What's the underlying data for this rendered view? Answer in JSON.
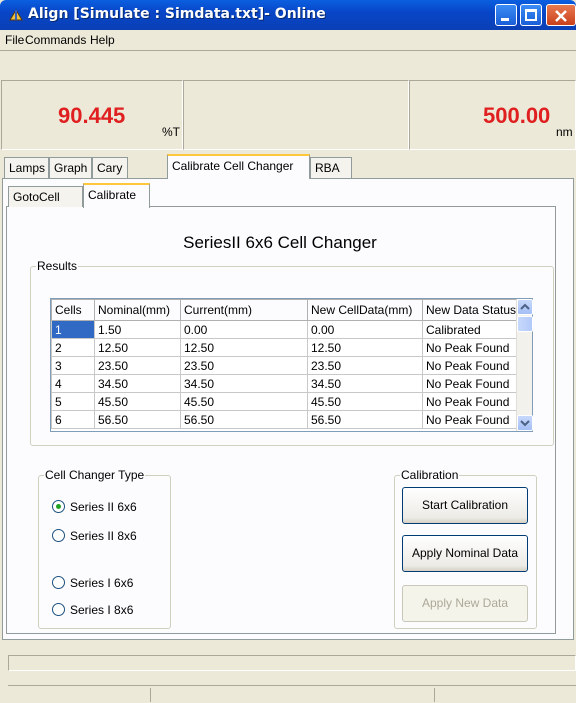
{
  "window": {
    "title": "Align [Simulate : Simdata.txt]- Online"
  },
  "menu": [
    {
      "label": "File"
    },
    {
      "label": "Commands"
    },
    {
      "label": "Help"
    }
  ],
  "readouts": {
    "transmittance": {
      "value": "90.445",
      "unit": "%T"
    },
    "wavelength": {
      "value": "500.00",
      "unit": "nm"
    }
  },
  "tabs": [
    "Lamps",
    "Graph",
    "Cary",
    "Calibrate Cell Changer",
    "RBA"
  ],
  "active_tab": "Calibrate Cell Changer",
  "subtabs": [
    "GotoCell",
    "Calibrate"
  ],
  "active_subtab": "Calibrate",
  "cell_changer_title": "SeriesII 6x6 Cell Changer",
  "results": {
    "label": "Results",
    "columns": [
      "Cells",
      "Nominal(mm)",
      "Current(mm)",
      "New CellData(mm)",
      "New Data Status"
    ],
    "rows": [
      [
        "1",
        "1.50",
        "0.00",
        "0.00",
        "Calibrated"
      ],
      [
        "2",
        "12.50",
        "12.50",
        "12.50",
        "No Peak Found"
      ],
      [
        "3",
        "23.50",
        "23.50",
        "23.50",
        "No Peak Found"
      ],
      [
        "4",
        "34.50",
        "34.50",
        "34.50",
        "No Peak Found"
      ],
      [
        "5",
        "45.50",
        "45.50",
        "45.50",
        "No Peak Found"
      ],
      [
        "6",
        "56.50",
        "56.50",
        "56.50",
        "No Peak Found"
      ]
    ]
  },
  "cell_changer_type": {
    "label": "Cell Changer Type",
    "options": [
      "Series II 6x6",
      "Series II 8x6",
      "Series I 6x6",
      "Series I 8x6"
    ],
    "selected": "Series II 6x6"
  },
  "calibration": {
    "label": "Calibration",
    "start_label": "Start Calibration",
    "apply_nominal_label": "Apply Nominal Data",
    "apply_new_label": "Apply New Data"
  }
}
